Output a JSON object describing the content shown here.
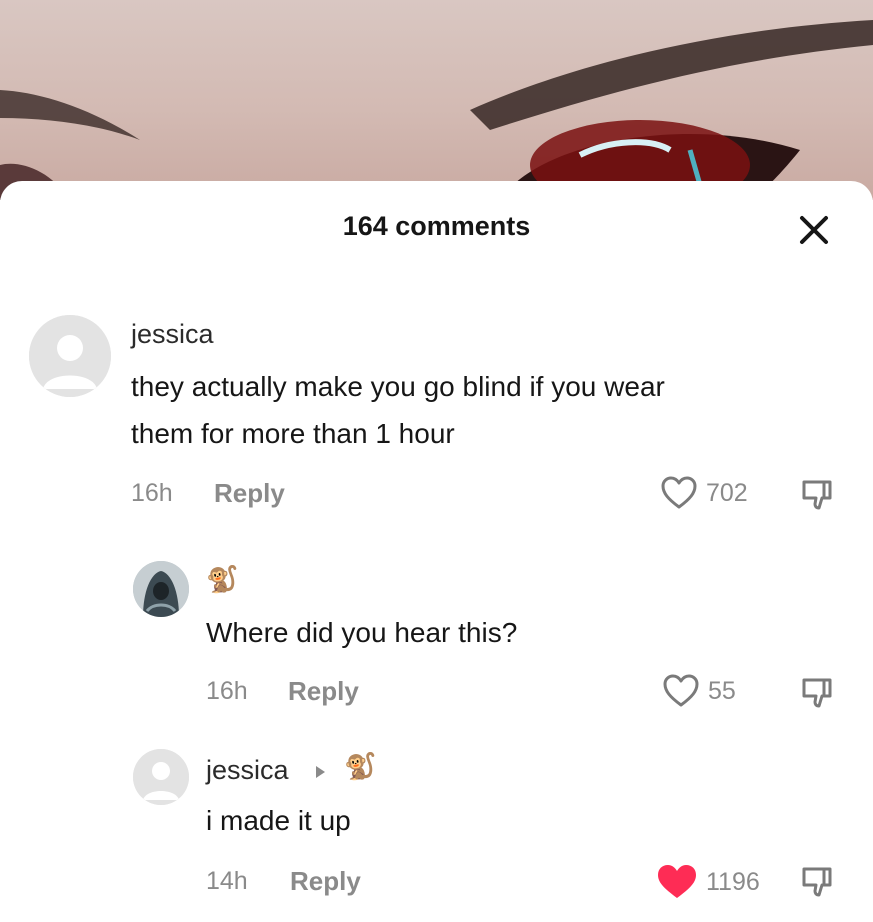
{
  "sheet": {
    "title": "164 comments"
  },
  "comments": [
    {
      "username": "jessica",
      "text_line1": "they actually make you go blind if you wear",
      "text_line2": "them for more than 1 hour",
      "time": "16h",
      "reply_label": "Reply",
      "likes": "702",
      "liked": false
    },
    {
      "username_emoji": "🐒",
      "text": "Where did you hear this?",
      "time": "16h",
      "reply_label": "Reply",
      "likes": "55",
      "liked": false
    },
    {
      "username": "jessica",
      "reply_to_emoji": "🐒",
      "text": "i made it up",
      "time": "14h",
      "reply_label": "Reply",
      "likes": "1196",
      "liked": true
    }
  ],
  "colors": {
    "liked_heart": "#fe2c55",
    "muted": "#8a8a8a"
  }
}
